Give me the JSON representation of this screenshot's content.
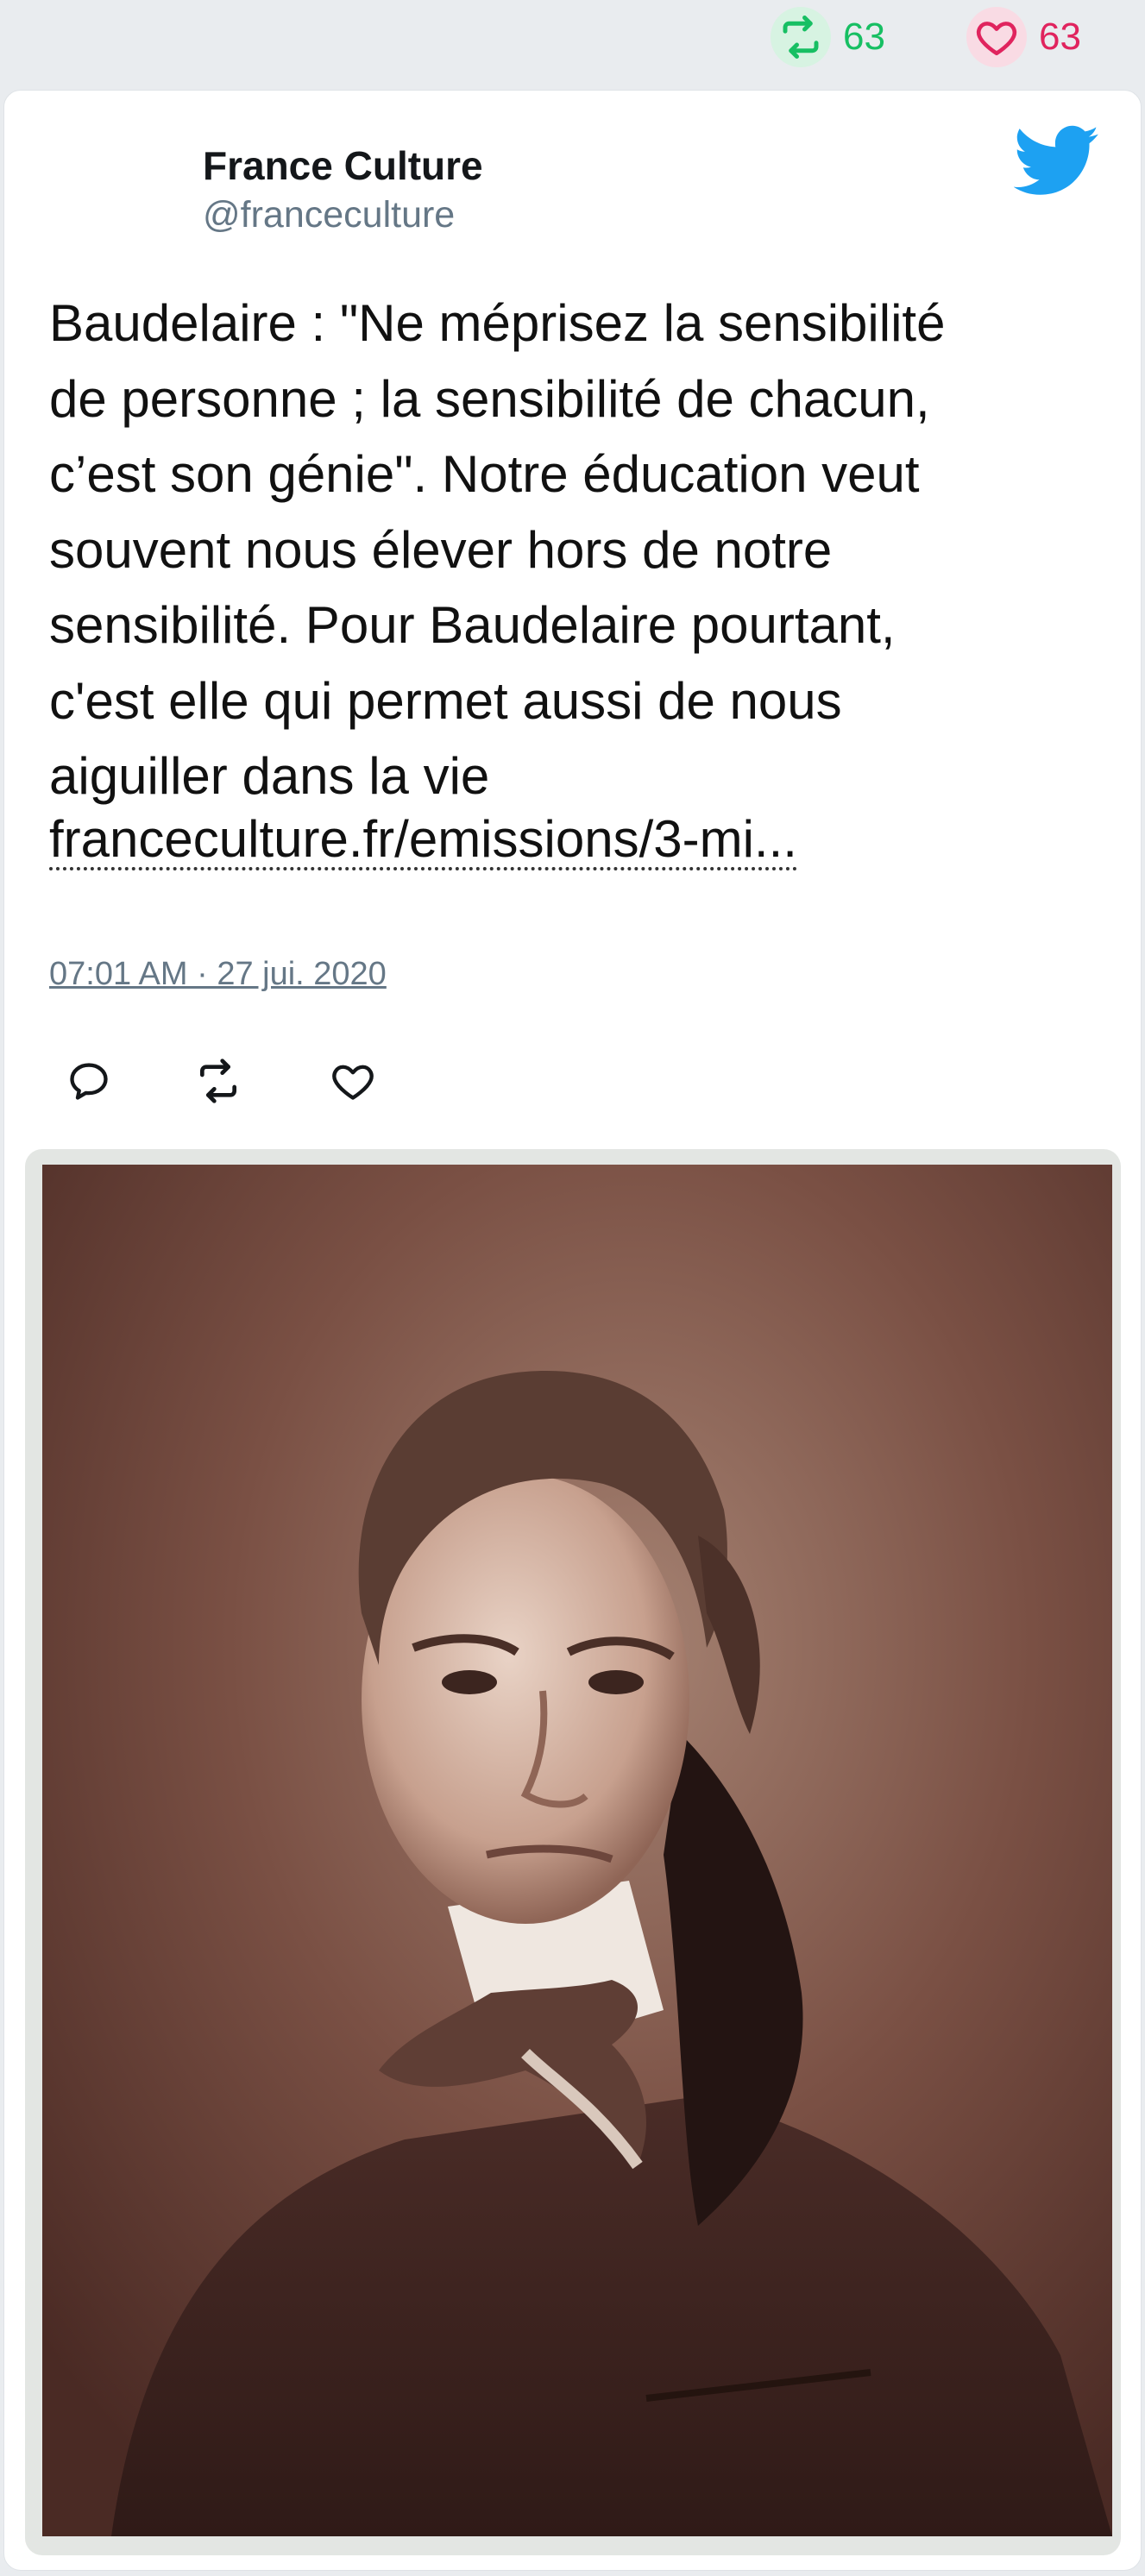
{
  "stats": {
    "retweet_count": "63",
    "like_count": "63"
  },
  "tweet": {
    "author_name": "France Culture",
    "author_handle": "@franceculture",
    "text_lines": [
      "Baudelaire : \"Ne méprisez la sensibilité",
      "de personne ; la sensibilité de chacun,",
      "c’est son génie\". Notre éducation veut",
      "souvent nous élever hors de notre",
      "sensibilité. Pour Baudelaire pourtant,",
      "c'est elle qui permet aussi de nous",
      "aiguiller dans la vie"
    ],
    "link_text": "franceculture.fr/emissions/3-mi...",
    "timestamp": "07:01 AM · 27 jui. 2020"
  },
  "icons": {
    "retweet": "retweet-icon",
    "like": "heart-icon",
    "reply": "reply-icon",
    "brand": "twitter-bird-icon"
  },
  "colors": {
    "retweet_green": "#17bf63",
    "like_red": "#e0245e",
    "twitter_blue": "#1da1f2",
    "handle_gray": "#657786"
  }
}
